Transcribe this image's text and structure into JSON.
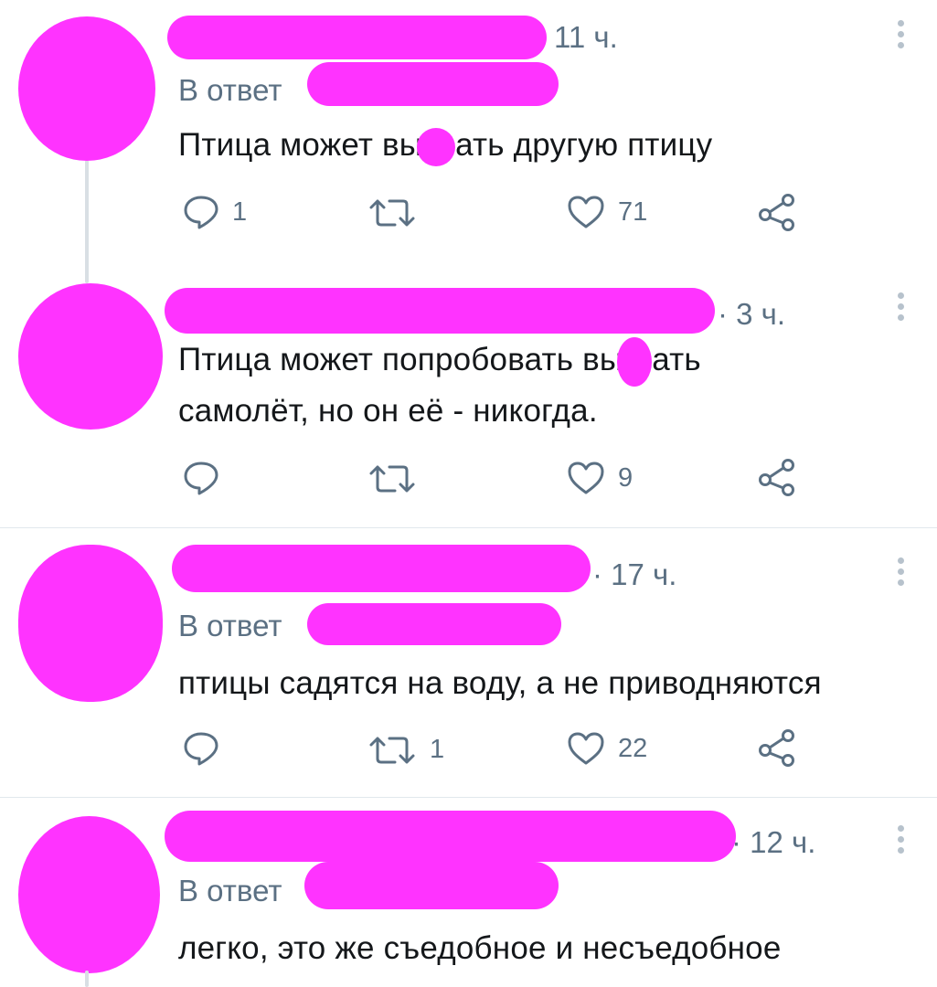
{
  "reply_prefix": "В ответ",
  "tweets": [
    {
      "time": "11 ч.",
      "reply": true,
      "text_a": "Птица может вы",
      "text_b": "ать другую птицу",
      "text_c": "",
      "replies": "1",
      "retweets": "",
      "likes": "71"
    },
    {
      "time": "· 3 ч.",
      "reply": false,
      "text_a": "Птица может попробовать вы",
      "text_b": "ать",
      "text_c": "самолёт, но он её - никогда.",
      "replies": "",
      "retweets": "",
      "likes": "9"
    },
    {
      "time": "· 17 ч.",
      "reply": true,
      "text_a": "птицы садятся на воду, а не приводняются",
      "text_b": "",
      "text_c": "",
      "replies": "",
      "retweets": "1",
      "likes": "22"
    },
    {
      "time": "· 12 ч.",
      "reply": true,
      "text_a": "легко, это же съедобное и несъедобное",
      "text_b": "",
      "text_c": "",
      "replies": "",
      "retweets": "",
      "likes": ""
    }
  ],
  "colors": {
    "redaction": "#ff33ff",
    "muted": "#5b7083"
  },
  "icons": [
    "reply-icon",
    "retweet-icon",
    "like-icon",
    "share-icon",
    "more-icon"
  ]
}
